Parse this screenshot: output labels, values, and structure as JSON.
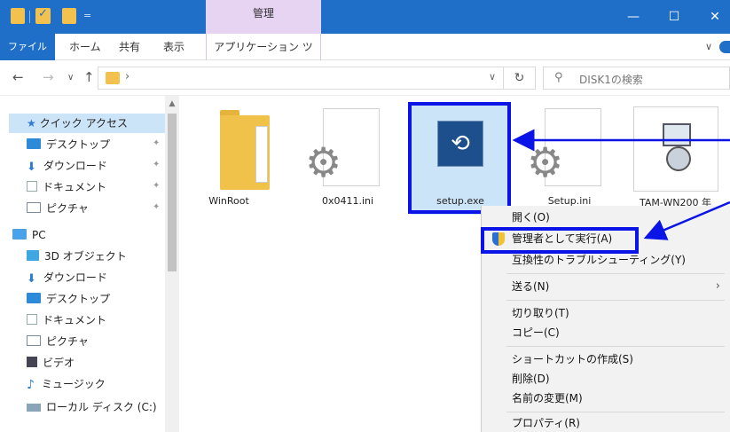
{
  "titlebar": {
    "manage_tab": "管理",
    "minimize": "—",
    "maximize": "☐",
    "close": "✕",
    "quick_access_down": "="
  },
  "ribbon": {
    "tabs": [
      "ファイル",
      "ホーム",
      "共有",
      "表示",
      "アプリケーション ツール"
    ],
    "expand": "∨"
  },
  "address": {
    "back": "←",
    "forward": "→",
    "recent": "∨",
    "up": "↑",
    "chevron": "›",
    "dropdown": "∨",
    "refresh": "↻",
    "search_placeholder": "DISK1の検索"
  },
  "sidebar": {
    "items": [
      {
        "label": "クイック アクセス",
        "icon": "star-icon"
      },
      {
        "label": "デスクトップ",
        "icon": "desktop-icon"
      },
      {
        "label": "ダウンロード",
        "icon": "download-icon"
      },
      {
        "label": "ドキュメント",
        "icon": "document-icon"
      },
      {
        "label": "ピクチャ",
        "icon": "pictures-icon"
      },
      {
        "label": "PC",
        "icon": "pc-icon"
      },
      {
        "label": "3D オブジェクト",
        "icon": "3d-objects-icon"
      },
      {
        "label": "ダウンロード",
        "icon": "download-icon"
      },
      {
        "label": "デスクトップ",
        "icon": "desktop-icon"
      },
      {
        "label": "ドキュメント",
        "icon": "document-icon"
      },
      {
        "label": "ピクチャ",
        "icon": "pictures-icon"
      },
      {
        "label": "ビデオ",
        "icon": "video-icon"
      },
      {
        "label": "ミュージック",
        "icon": "music-icon"
      },
      {
        "label": "ローカル ディスク (C:)",
        "icon": "drive-icon"
      }
    ],
    "pin": "📌"
  },
  "files": [
    {
      "name": "WinRoot",
      "icon": "folder-icon"
    },
    {
      "name": "0x0411.ini",
      "icon": "settings-file-icon"
    },
    {
      "name": "setup.exe",
      "icon": "setup-exe-icon"
    },
    {
      "name": "Setup.ini",
      "icon": "settings-file-icon"
    },
    {
      "name": "TAM-WN200 年",
      "icon": "installer-icon"
    }
  ],
  "context_menu": {
    "items": [
      "開く(O)",
      "管理者として実行(A)",
      "互換性のトラブルシューティング(Y)",
      "送る(N)",
      "切り取り(T)",
      "コピー(C)",
      "ショートカットの作成(S)",
      "削除(D)",
      "名前の変更(M)",
      "プロパティ(R)"
    ],
    "submenu_arrow": "›"
  },
  "colors": {
    "titlebar": "#1f6fc8",
    "manage_tab": "#e7d3f2",
    "selection": "#cce4f7",
    "highlight_frame": "#0a14e6",
    "menu_bg": "#f2f2f2"
  }
}
